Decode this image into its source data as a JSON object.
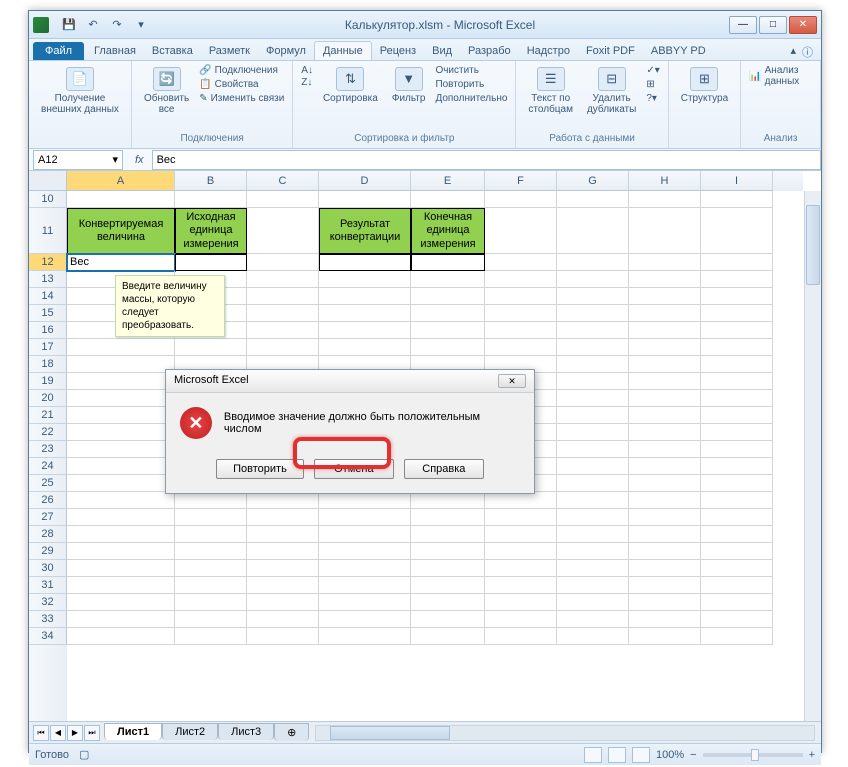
{
  "title": "Калькулятор.xlsm - Microsoft Excel",
  "qat": {
    "save": "💾",
    "undo": "↶",
    "redo": "↷"
  },
  "tabs": {
    "file": "Файл",
    "items": [
      "Главная",
      "Вставка",
      "Разметк",
      "Формул",
      "Данные",
      "Реценз",
      "Вид",
      "Разрабо",
      "Надстро",
      "Foxit PDF",
      "ABBYY PD"
    ]
  },
  "ribbon": {
    "external_data": "Получение\nвнешних данных",
    "refresh": "Обновить\nвсе",
    "connections_group": "Подключения",
    "connections_item": "Подключения",
    "properties": "Свойства",
    "edit_links": "Изменить связи",
    "sort": "Сортировка",
    "filter": "Фильтр",
    "sortfilter_group": "Сортировка и фильтр",
    "clear": "Очистить",
    "reapply": "Повторить",
    "advanced": "Дополнительно",
    "text_cols": "Текст по\nстолбцам",
    "remove_dup": "Удалить\nдубликаты",
    "datatools_group": "Работа с данными",
    "outline": "Структура",
    "analysis": "Анализ данных",
    "analysis_group": "Анализ"
  },
  "namebox": "A12",
  "formula_value": "Вес",
  "columns": [
    "A",
    "B",
    "C",
    "D",
    "E",
    "F",
    "G",
    "H",
    "I"
  ],
  "row_start": 10,
  "row_end": 34,
  "headers": {
    "a11": "Конвертируемая величина",
    "b11": "Исходная единица измерения",
    "d11": "Результат конвертаиции",
    "e11": "Конечная единица измерения"
  },
  "cells": {
    "a12": "Вес"
  },
  "tooltip": "Введите величину массы, которую следует преобразовать.",
  "dialog": {
    "title": "Microsoft Excel",
    "message": "Вводимое значение должно быть положительным числом",
    "retry": "Повторить",
    "cancel": "Отмена",
    "help": "Справка"
  },
  "sheets": [
    "Лист1",
    "Лист2",
    "Лист3"
  ],
  "status": {
    "ready": "Готово",
    "zoom": "100%"
  }
}
